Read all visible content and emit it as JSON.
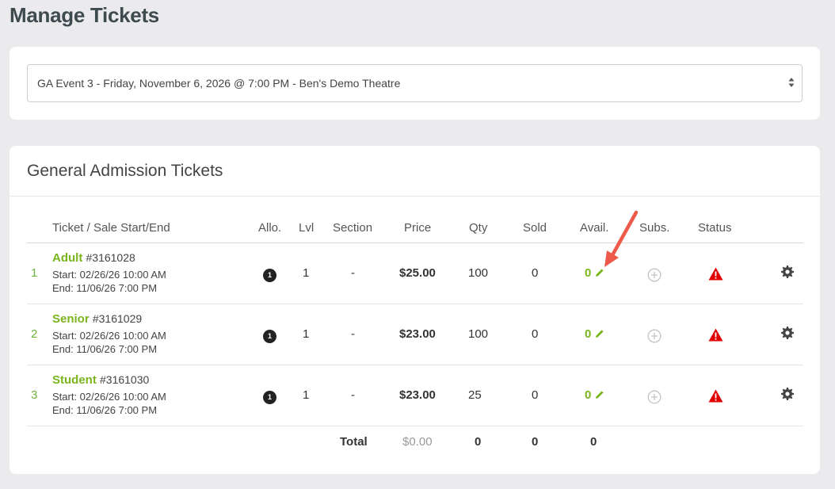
{
  "page": {
    "title": "Manage Tickets"
  },
  "event_select": {
    "selected": "GA Event 3 - Friday, November 6, 2026 @ 7:00 PM - Ben's Demo Theatre"
  },
  "tickets_card": {
    "title": "General Admission Tickets"
  },
  "table": {
    "headers": {
      "ticket": "Ticket / Sale Start/End",
      "allo": "Allo.",
      "lvl": "Lvl",
      "section": "Section",
      "price": "Price",
      "qty": "Qty",
      "sold": "Sold",
      "avail": "Avail.",
      "subs": "Subs.",
      "status": "Status"
    },
    "rows": [
      {
        "index": "1",
        "name": "Adult",
        "id": "#3161028",
        "start": "Start: 02/26/26 10:00 AM",
        "end": "End: 11/06/26 7:00 PM",
        "allo": "1",
        "lvl": "1",
        "section": "-",
        "price": "$25.00",
        "qty": "100",
        "sold": "0",
        "avail": "0"
      },
      {
        "index": "2",
        "name": "Senior",
        "id": "#3161029",
        "start": "Start: 02/26/26 10:00 AM",
        "end": "End: 11/06/26 7:00 PM",
        "allo": "1",
        "lvl": "1",
        "section": "-",
        "price": "$23.00",
        "qty": "100",
        "sold": "0",
        "avail": "0"
      },
      {
        "index": "3",
        "name": "Student",
        "id": "#3161030",
        "start": "Start: 02/26/26 10:00 AM",
        "end": "End: 11/06/26 7:00 PM",
        "allo": "1",
        "lvl": "1",
        "section": "-",
        "price": "$23.00",
        "qty": "25",
        "sold": "0",
        "avail": "0"
      }
    ],
    "totals": {
      "label": "Total",
      "price": "$0.00",
      "qty": "0",
      "sold": "0",
      "avail": "0"
    }
  },
  "icons": {
    "alloc": "number-badge-icon",
    "edit": "pencil-icon",
    "subs": "plus-circle-icon",
    "status": "warning-triangle-icon",
    "settings": "gear-icon",
    "annotation": "red-arrow"
  },
  "colors": {
    "accent_green": "#7ab51d",
    "warning_red": "#e00000",
    "arrow_red": "#ee5a4a",
    "background": "#ebebed"
  }
}
